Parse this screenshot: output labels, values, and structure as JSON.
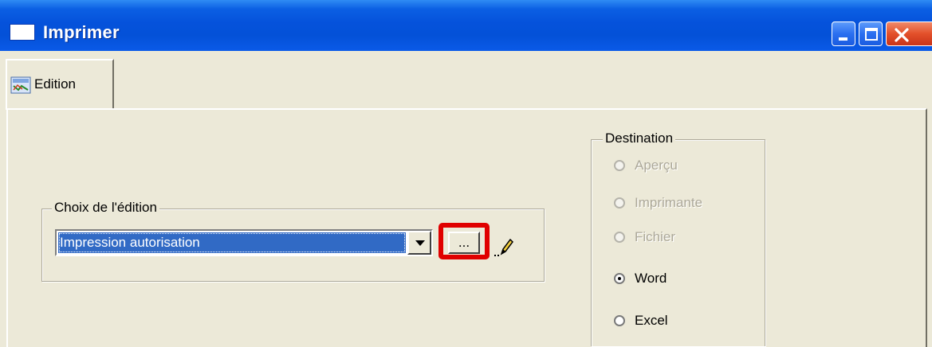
{
  "window": {
    "title": "Imprimer"
  },
  "tab": {
    "label": "Edition"
  },
  "choix": {
    "legend": "Choix de l'édition",
    "selected_value": "Impression autorisation",
    "browse_label": "..."
  },
  "destination": {
    "legend": "Destination",
    "options": [
      {
        "label": "Aperçu",
        "enabled": false,
        "checked": false
      },
      {
        "label": "Imprimante",
        "enabled": false,
        "checked": false
      },
      {
        "label": "Fichier",
        "enabled": false,
        "checked": false
      },
      {
        "label": "Word",
        "enabled": true,
        "checked": true
      },
      {
        "label": "Excel",
        "enabled": true,
        "checked": false
      }
    ]
  },
  "colors": {
    "titlebar": "#0552db",
    "window_bg": "#ece9d8",
    "selection": "#316ac5",
    "highlight": "#e00000"
  }
}
